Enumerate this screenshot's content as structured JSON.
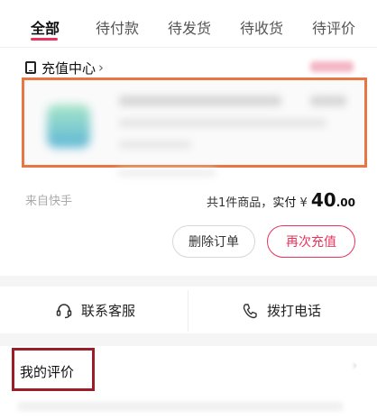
{
  "tabs": [
    {
      "label": "全部",
      "active": true
    },
    {
      "label": "待付款",
      "active": false
    },
    {
      "label": "待发货",
      "active": false
    },
    {
      "label": "待收货",
      "active": false
    },
    {
      "label": "待评价",
      "active": false
    }
  ],
  "order": {
    "store_icon": "phone-icon",
    "store_name": "充值中心",
    "source": "来自快手",
    "summary_prefix": "共1件商品，",
    "paid_label": "实付",
    "currency": "¥",
    "amount_int": "40",
    "amount_cents": ".00",
    "buttons": {
      "delete": "删除订单",
      "recharge": "再次充值"
    }
  },
  "contact": {
    "service_label": "联系客服",
    "service_icon": "headset-icon",
    "call_label": "拨打电话",
    "call_icon": "phone-handset-icon"
  },
  "review": {
    "title": "我的评价"
  },
  "colors": {
    "accent": "#e8335d",
    "highlight_orange": "#e67742",
    "highlight_red": "#9c1c27"
  }
}
